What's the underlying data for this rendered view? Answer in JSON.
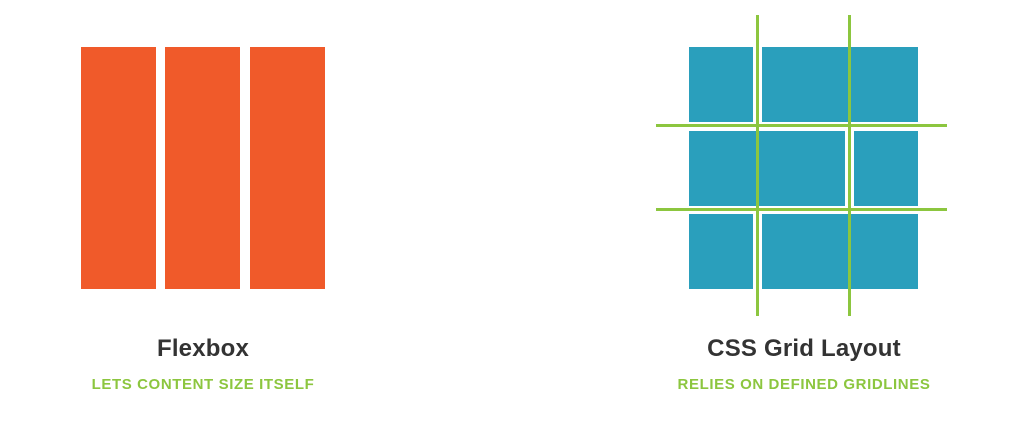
{
  "flexbox": {
    "title": "Flexbox",
    "subtitle": "LETS CONTENT SIZE ITSELF",
    "column_color": "#f05a2a"
  },
  "grid": {
    "title": "CSS Grid Layout",
    "subtitle": "RELIES ON DEFINED GRIDLINES",
    "cell_color": "#2a9fbc",
    "gridline_color": "#8cc63f"
  }
}
